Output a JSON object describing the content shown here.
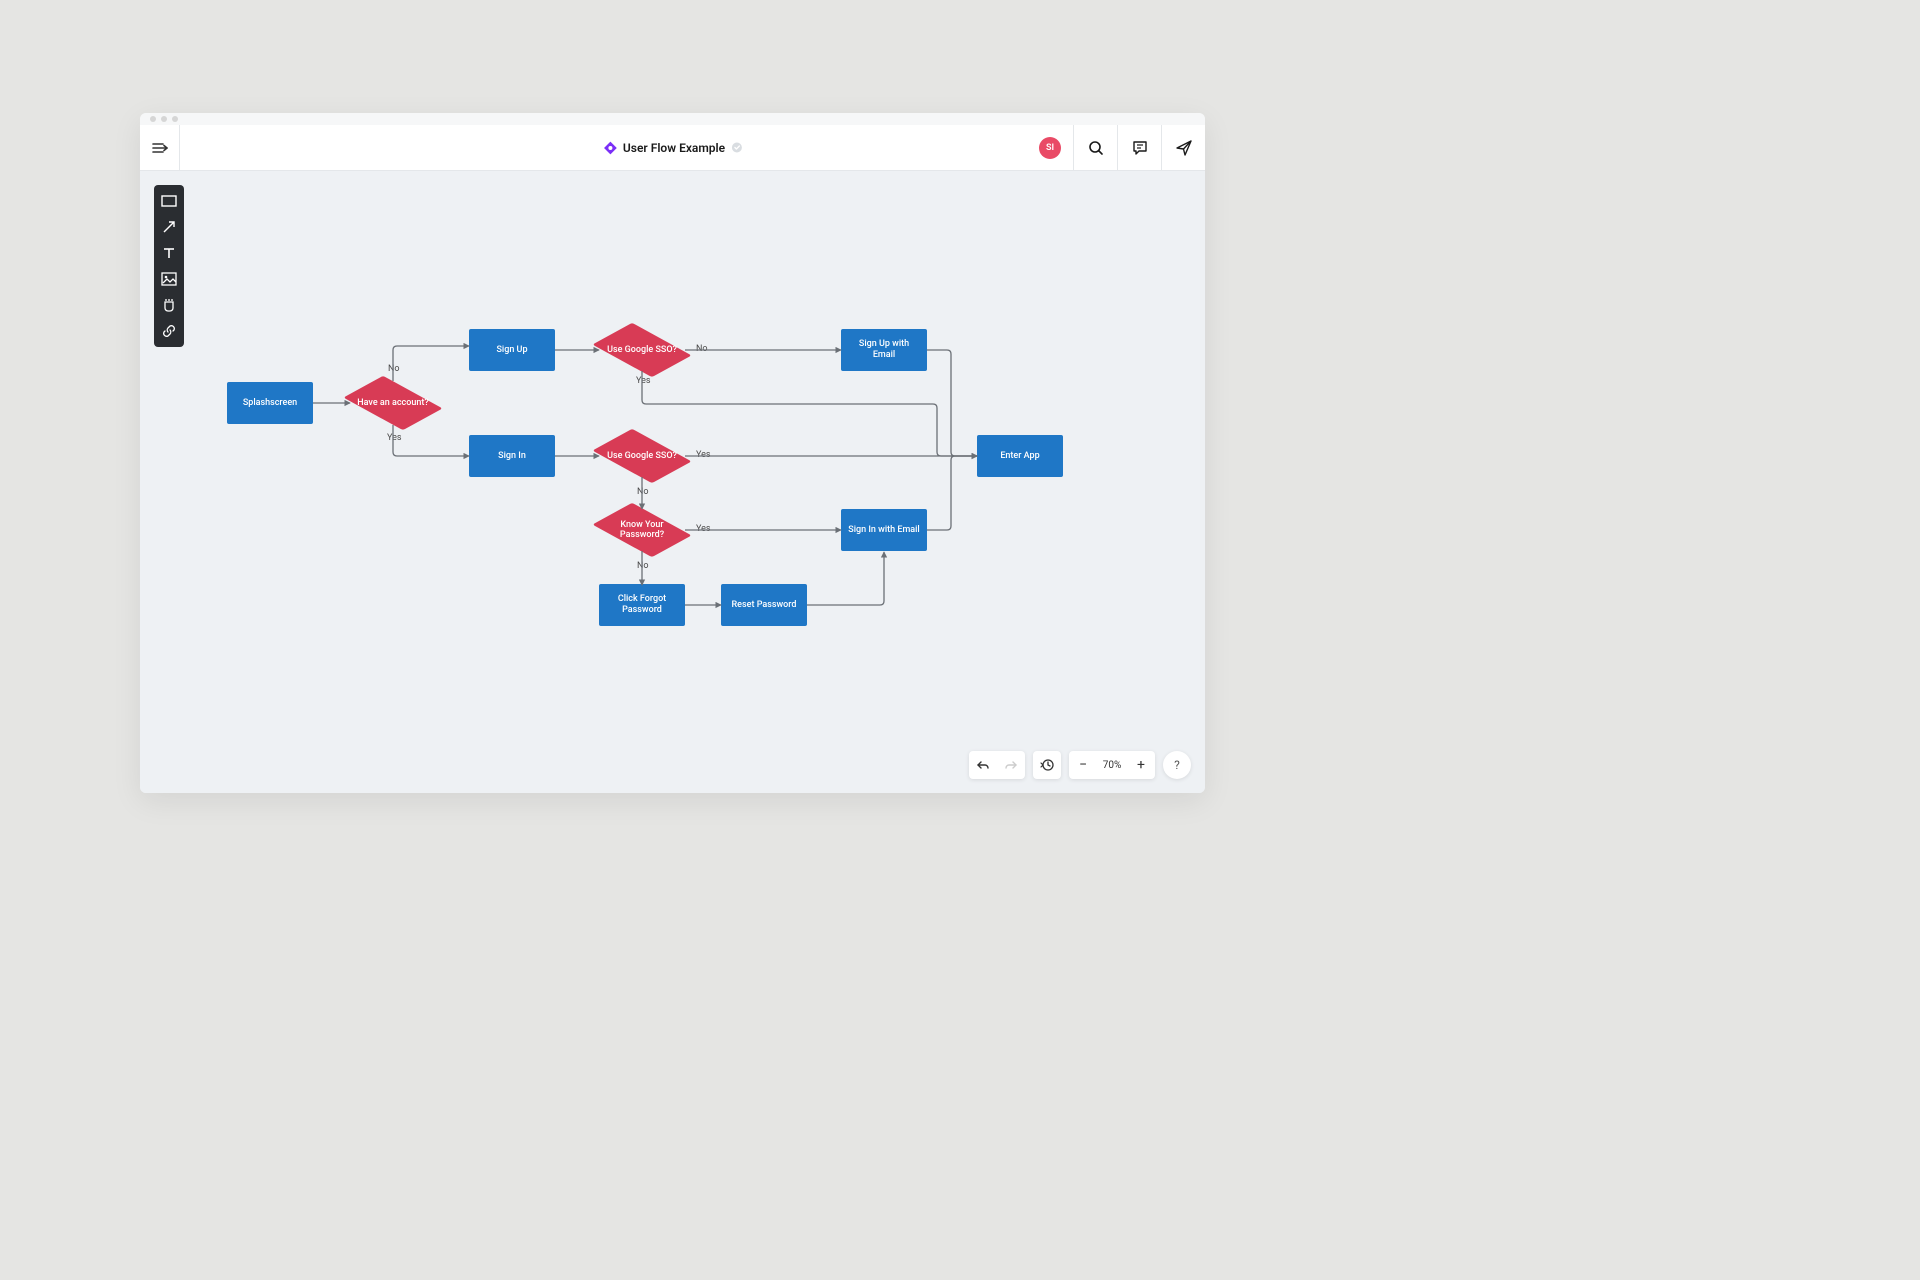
{
  "header": {
    "title": "User Flow Example",
    "avatar_initials": "SI"
  },
  "palette": {
    "tools": [
      "rectangle",
      "arrow",
      "text",
      "image",
      "sticky-note",
      "link"
    ]
  },
  "nodes": {
    "splashscreen": "Splashscreen",
    "have_account": "Have an account?",
    "sign_up": "Sign Up",
    "sign_in": "Sign In",
    "sso_up": "Use Google SSO?",
    "sso_in": "Use Google SSO?",
    "know_pw": "Know Your Password?",
    "signup_email": "Sign Up with Email",
    "signin_email": "Sign In with Email",
    "click_forgot": "Click Forgot Password",
    "reset_pw": "Reset Password",
    "enter_app": "Enter App"
  },
  "edge_labels": {
    "no": "No",
    "yes": "Yes"
  },
  "footer": {
    "zoom": "70%",
    "help": "?"
  }
}
